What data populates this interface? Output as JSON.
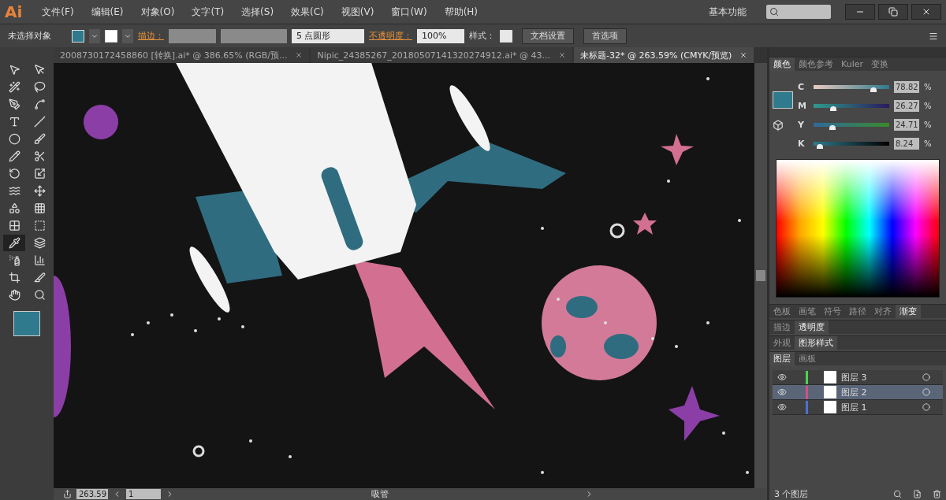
{
  "app": {
    "logo": "Ai",
    "menu": [
      "文件(F)",
      "编辑(E)",
      "对象(O)",
      "文字(T)",
      "选择(S)",
      "效果(C)",
      "视图(V)",
      "窗口(W)",
      "帮助(H)"
    ],
    "workspace": "基本功能"
  },
  "control_bar": {
    "selection": "未选择对象",
    "stroke_label": "描边：",
    "brush": "5 点圆形",
    "opacity_label": "不透明度：",
    "opacity": "100%",
    "style_label": "样式：",
    "buttons": [
      "文档设置",
      "首选项"
    ]
  },
  "tabs": [
    {
      "label": "2008730172458860 [转换].ai* @ 386.65% (RGB/预...",
      "selected": false
    },
    {
      "label": "Nipic_24385267_20180507141320274912.ai* @ 43...",
      "selected": false
    },
    {
      "label": "未标题-32* @ 263.59% (CMYK/预览)",
      "selected": true
    }
  ],
  "tools": [
    {
      "kind": "select",
      "selected": false
    },
    {
      "kind": "direct",
      "selected": false
    },
    {
      "kind": "wand",
      "selected": false
    },
    {
      "kind": "lasso",
      "selected": false
    },
    {
      "kind": "pen",
      "selected": false
    },
    {
      "kind": "curvature",
      "selected": false
    },
    {
      "kind": "type",
      "selected": false
    },
    {
      "kind": "line",
      "selected": false
    },
    {
      "kind": "ellipse",
      "selected": false
    },
    {
      "kind": "brush",
      "selected": false
    },
    {
      "kind": "pencil",
      "selected": false
    },
    {
      "kind": "scissors",
      "selected": false
    },
    {
      "kind": "rotate",
      "selected": false
    },
    {
      "kind": "scale",
      "selected": false
    },
    {
      "kind": "warp",
      "selected": false
    },
    {
      "kind": "free",
      "selected": false
    },
    {
      "kind": "shape",
      "selected": false
    },
    {
      "kind": "perspective",
      "selected": false
    },
    {
      "kind": "mesh",
      "selected": false
    },
    {
      "kind": "gradient",
      "selected": false
    },
    {
      "kind": "eyedropper",
      "selected": true
    },
    {
      "kind": "blend",
      "selected": false
    },
    {
      "kind": "symbol",
      "selected": false
    },
    {
      "kind": "graph",
      "selected": false
    },
    {
      "kind": "artboard",
      "selected": false
    },
    {
      "kind": "knife",
      "selected": false
    },
    {
      "kind": "hand",
      "selected": false
    },
    {
      "kind": "zoom",
      "selected": false
    }
  ],
  "color_panel": {
    "tabs": [
      {
        "label": "颜色",
        "selected": true
      },
      {
        "label": "颜色参考",
        "selected": false
      },
      {
        "label": "Kuler",
        "selected": false
      },
      {
        "label": "变换",
        "selected": false
      }
    ],
    "sliders": [
      {
        "channel": "C",
        "level": 0.79,
        "reading": "78.82",
        "unit": "%"
      },
      {
        "channel": "M",
        "level": 0.26,
        "reading": "26.27",
        "unit": "%"
      },
      {
        "channel": "Y",
        "level": 0.25,
        "reading": "24.71",
        "unit": "%"
      },
      {
        "channel": "K",
        "level": 0.08,
        "reading": "8.24",
        "unit": "%"
      }
    ]
  },
  "panel_groups": [
    [
      {
        "label": "色板",
        "selected": false
      },
      {
        "label": "画笔",
        "selected": false
      },
      {
        "label": "符号",
        "selected": false
      },
      {
        "label": "路径",
        "selected": false
      },
      {
        "label": "对齐",
        "selected": false
      },
      {
        "label": "渐变",
        "selected": true
      }
    ],
    [
      {
        "label": "描边",
        "selected": false
      },
      {
        "label": "透明度",
        "selected": true
      }
    ],
    [
      {
        "label": "外观",
        "selected": false
      },
      {
        "label": "图形样式",
        "selected": true
      }
    ],
    [
      {
        "label": "图层",
        "selected": true
      },
      {
        "label": "画板",
        "selected": false
      }
    ]
  ],
  "layers": [
    {
      "name": "图层 3",
      "color": "#4fd14f",
      "selected": false
    },
    {
      "name": "图层 2",
      "color": "#d04f8a",
      "selected": true
    },
    {
      "name": "图层 1",
      "color": "#4f6fd1",
      "selected": false
    }
  ],
  "layer_count": "3 个图层",
  "status_bar": {
    "zoom": "263.59",
    "artboard": "1",
    "tool": "吸管"
  }
}
